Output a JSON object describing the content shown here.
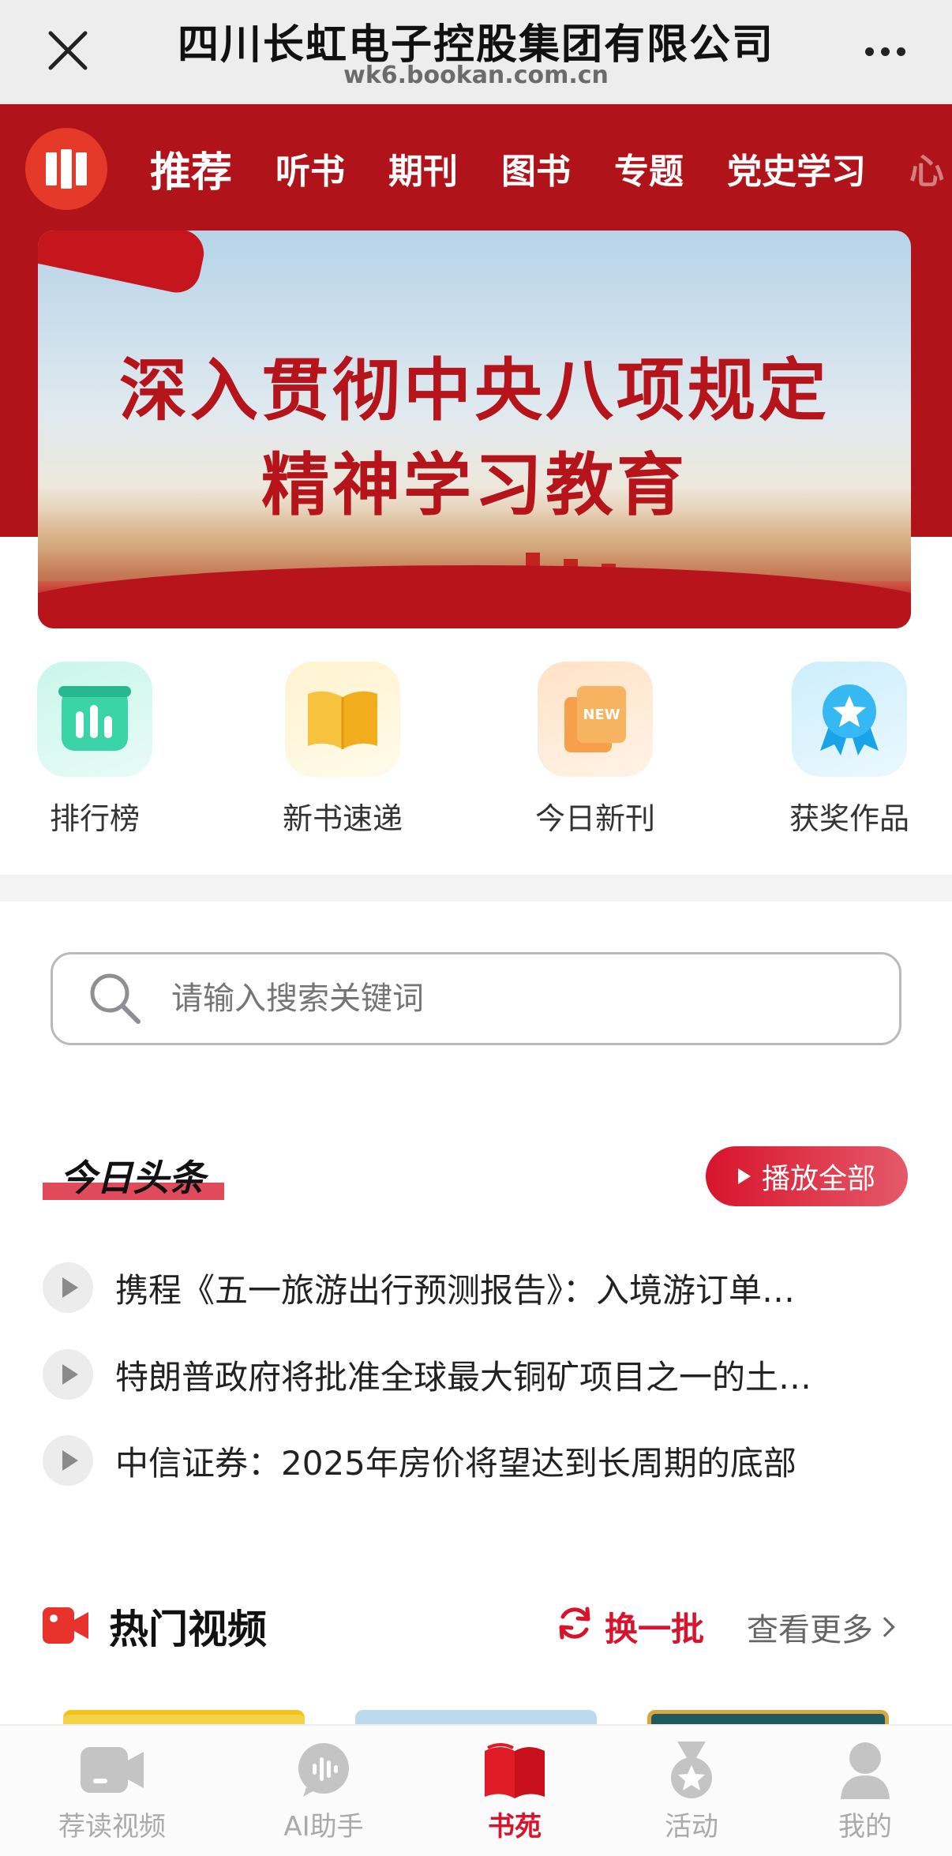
{
  "browser": {
    "title": "四川长虹电子控股集团有限公司",
    "url": "wk6.bookan.com.cn"
  },
  "header": {
    "tabs": [
      {
        "label": "推荐",
        "active": true
      },
      {
        "label": "听书"
      },
      {
        "label": "期刊"
      },
      {
        "label": "图书"
      },
      {
        "label": "专题"
      },
      {
        "label": "党史学习"
      },
      {
        "label": "心"
      }
    ],
    "accent_color": "#b0141a"
  },
  "banner": {
    "line1": "深入贯彻中央八项规定",
    "line2": "精神学习教育"
  },
  "quick_links": [
    {
      "label": "排行榜",
      "icon": "chart-icon"
    },
    {
      "label": "新书速递",
      "icon": "book-icon"
    },
    {
      "label": "今日新刊",
      "icon": "new-magazine-icon"
    },
    {
      "label": "获奖作品",
      "icon": "award-icon"
    }
  ],
  "search": {
    "placeholder": "请输入搜索关键词"
  },
  "headlines": {
    "title": "今日头条",
    "play_all": "播放全部",
    "items": [
      "携程《五一旅游出行预测报告》：入境游订单…",
      "特朗普政府将批准全球最大铜矿项目之一的土…",
      "中信证券：2025年房价将望达到长周期的底部"
    ]
  },
  "hot_videos": {
    "title": "热门视频",
    "refresh": "换一批",
    "more": "查看更多"
  },
  "bottom_nav": [
    {
      "label": "荐读视频",
      "icon": "video-icon"
    },
    {
      "label": "AI助手",
      "icon": "ai-assistant-icon"
    },
    {
      "label": "书苑",
      "icon": "open-book-icon",
      "active": true
    },
    {
      "label": "活动",
      "icon": "medal-icon"
    },
    {
      "label": "我的",
      "icon": "user-icon"
    }
  ]
}
